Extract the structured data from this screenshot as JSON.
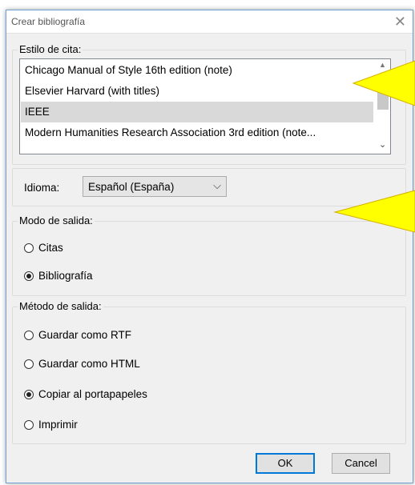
{
  "window": {
    "title": "Crear bibliografía"
  },
  "citation_style": {
    "label": "Estilo de cita:",
    "items": [
      "Chicago Manual of Style 16th edition (note)",
      "Elsevier Harvard (with titles)",
      "IEEE",
      "Modern Humanities Research Association 3rd edition (note..."
    ],
    "selected": "IEEE"
  },
  "language": {
    "label": "Idioma:",
    "value": "Español (España)"
  },
  "output_mode": {
    "label": "Modo de salida:",
    "options": [
      "Citas",
      "Bibliografía"
    ],
    "selected": "Bibliografía"
  },
  "output_method": {
    "label": "Método de salida:",
    "options": [
      "Guardar como RTF",
      "Guardar como HTML",
      "Copiar al portapapeles",
      "Imprimir"
    ],
    "selected": "Copiar al portapapeles"
  },
  "buttons": {
    "ok": "OK",
    "cancel": "Cancel"
  },
  "colors": {
    "callout": "#ffff00",
    "default_button_border": "#0078d7"
  }
}
